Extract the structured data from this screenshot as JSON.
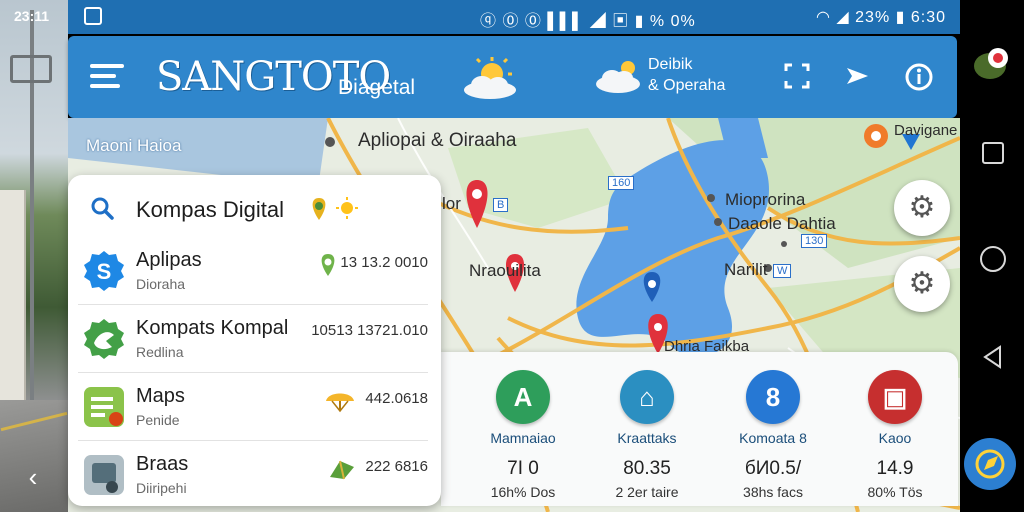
{
  "status_bar": {
    "time_left": "23:11",
    "center_icons": "ⓠ ⓪ ⓪ ▌▌▌ ◢ ▣ ▮ % 0%",
    "right_icons": "◠ ◢ 23% ▮ 6:30"
  },
  "header": {
    "brand": "SANGTOTO",
    "subtitle": "Diagetal",
    "weather_line1": "Deibik",
    "weather_line2": "& Operaha",
    "icons": [
      "menu-icon",
      "sun-cloud-icon",
      "cloud-sun-icon",
      "fullscreen-icon",
      "navigate-icon",
      "info-icon"
    ]
  },
  "map": {
    "corner_label": "Maoni Haioa",
    "labels": {
      "top_center": "Apliopai & Oiraaha",
      "right_top": "Davigane",
      "right_1": "Mioprorina",
      "right_2": "Daaole Dahtia",
      "mid_left": "Nraouilita",
      "mid_right": "Narilit",
      "bottom": "Dhria Faikba",
      "left_partial": "lor"
    },
    "badges": [
      "160",
      "B",
      "130",
      "W"
    ]
  },
  "list_card": {
    "search_title": "Kompas Digital",
    "items": [
      {
        "title": "Aplipas",
        "subtitle": "Dioraha",
        "value": "13 13.2 0010",
        "color": "#1e88e5",
        "glyph": "S"
      },
      {
        "title": "Kompats Kompal",
        "subtitle": "Redlina",
        "value": "10513 13721.010",
        "color": "#43a047",
        "glyph": ""
      },
      {
        "title": "Maps",
        "subtitle": "Penide",
        "value": "442.0618",
        "color": "#8bc34a",
        "glyph": "≡"
      },
      {
        "title": "Braas",
        "subtitle": "Diiripehi",
        "value": "222 6816",
        "color": "#90a4ae",
        "glyph": ""
      }
    ]
  },
  "stats": {
    "items": [
      {
        "glyph": "A",
        "name": "Mamnaiao",
        "value": "7І 0",
        "unit": "16h% Dos",
        "color": "#2e9e5b"
      },
      {
        "glyph": "⌂",
        "name": "Kraattaks",
        "value": "80.35",
        "unit": "2 2er taire",
        "color": "#2b8fc1"
      },
      {
        "glyph": "8",
        "name": "Komoata 8",
        "value": "бИ0.5/",
        "unit": "38hs facs",
        "color": "#2678d4"
      },
      {
        "glyph": "▣",
        "name": "Kaoo",
        "value": "14.9",
        "unit": "80% Tös",
        "color": "#c62f2f"
      }
    ]
  },
  "nav": {
    "back_glyph": "◁",
    "left_back_glyph": "‹"
  }
}
